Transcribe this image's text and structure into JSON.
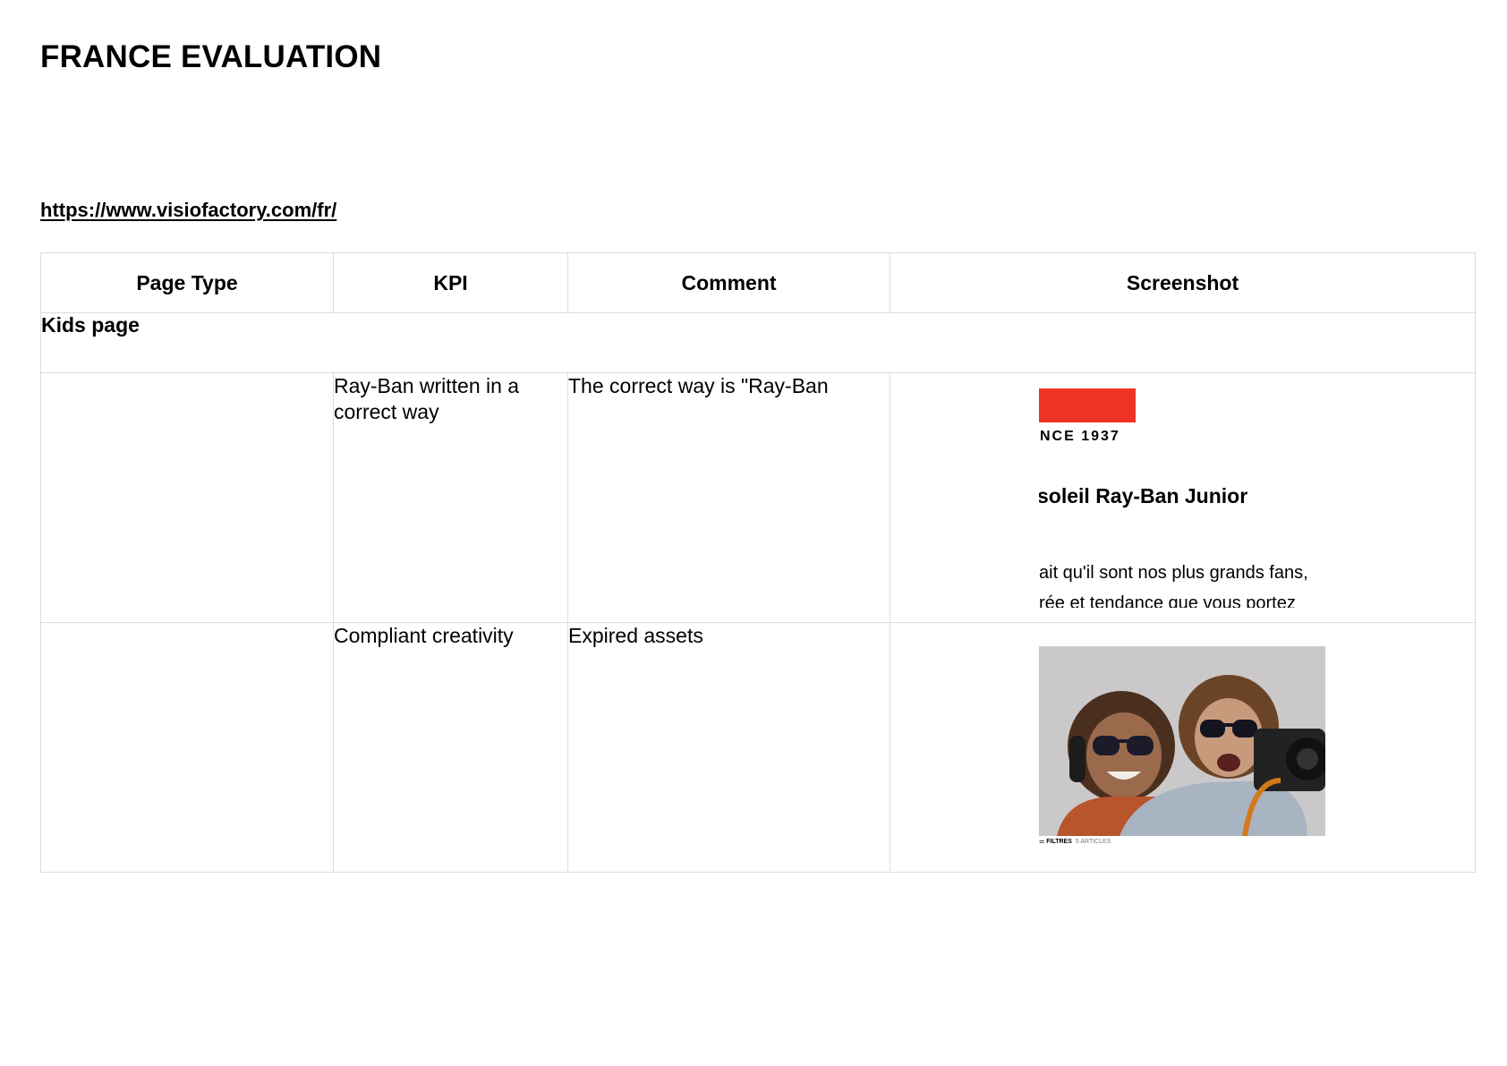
{
  "document": {
    "title": "FRANCE EVALUATION",
    "url": "https://www.visiofactory.com/fr/"
  },
  "table": {
    "headers": [
      "Page Type",
      "KPI",
      "Comment",
      "Screenshot"
    ],
    "section": "Kids page",
    "rows": [
      {
        "page_type": "",
        "kpi": "Ray-Ban written in a correct way",
        "comment": "The correct way is \"Ray-Ban",
        "screenshot": {
          "since_text": "NCE 1937",
          "heading_text": "soleil Ray-Ban Junior",
          "body_line1": "ait qu'il sont nos plus grands fans,",
          "body_line2": "rée et tendance que vous portez",
          "accent_color": "#ee3224"
        }
      },
      {
        "page_type": "",
        "kpi": "Compliant creativity",
        "comment": "Expired assets",
        "screenshot": {
          "filter_label": "FILTRES",
          "filter_extra": "5 ARTICLES"
        }
      }
    ]
  }
}
